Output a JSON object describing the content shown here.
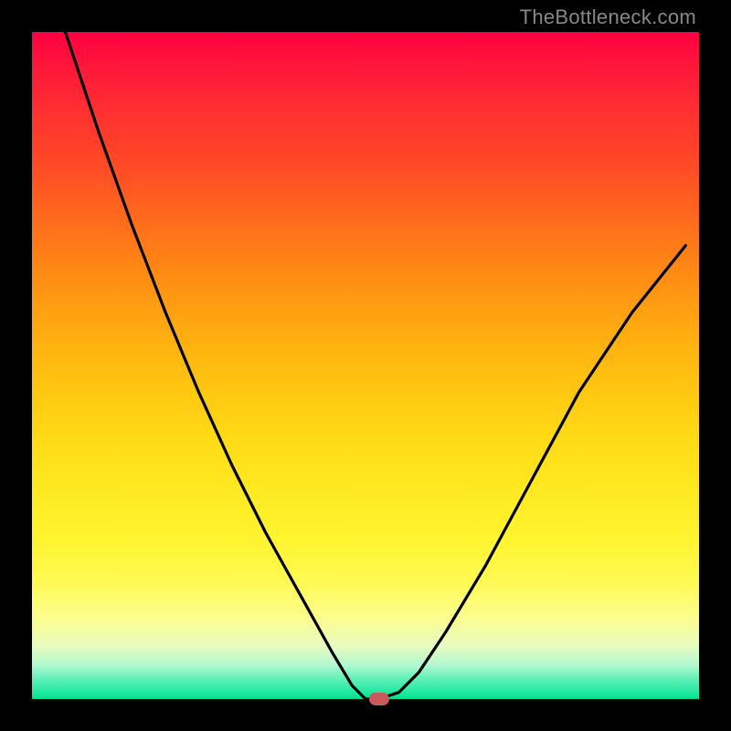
{
  "watermark": "TheBottleneck.com",
  "chart_data": {
    "type": "line",
    "title": "",
    "xlabel": "",
    "ylabel": "",
    "xlim": [
      0,
      100
    ],
    "ylim": [
      0,
      100
    ],
    "grid": false,
    "legend": false,
    "background_gradient": {
      "top": "#ff0040",
      "bottom": "#00e090",
      "note": "vertical gradient red (top, bad) through orange/yellow to green (bottom, good)"
    },
    "series": [
      {
        "name": "bottleneck-curve",
        "color": "#000000",
        "x": [
          5,
          10,
          15,
          20,
          25,
          30,
          35,
          40,
          45,
          48,
          50,
          52,
          55,
          58,
          62,
          68,
          75,
          82,
          90,
          98
        ],
        "y": [
          100,
          85,
          71,
          58,
          46,
          35,
          25,
          16,
          7,
          2,
          0,
          0,
          1,
          4,
          10,
          20,
          33,
          46,
          58,
          68
        ],
        "note": "V-shaped curve; minimum (≈0) around x≈50–52; left branch rises to 100 at left edge, right branch rises to ~68 near right edge"
      }
    ],
    "marker": {
      "x": 52,
      "y": 0,
      "color": "#c85a5a",
      "shape": "rounded-rect"
    }
  },
  "frame_color": "#000000"
}
